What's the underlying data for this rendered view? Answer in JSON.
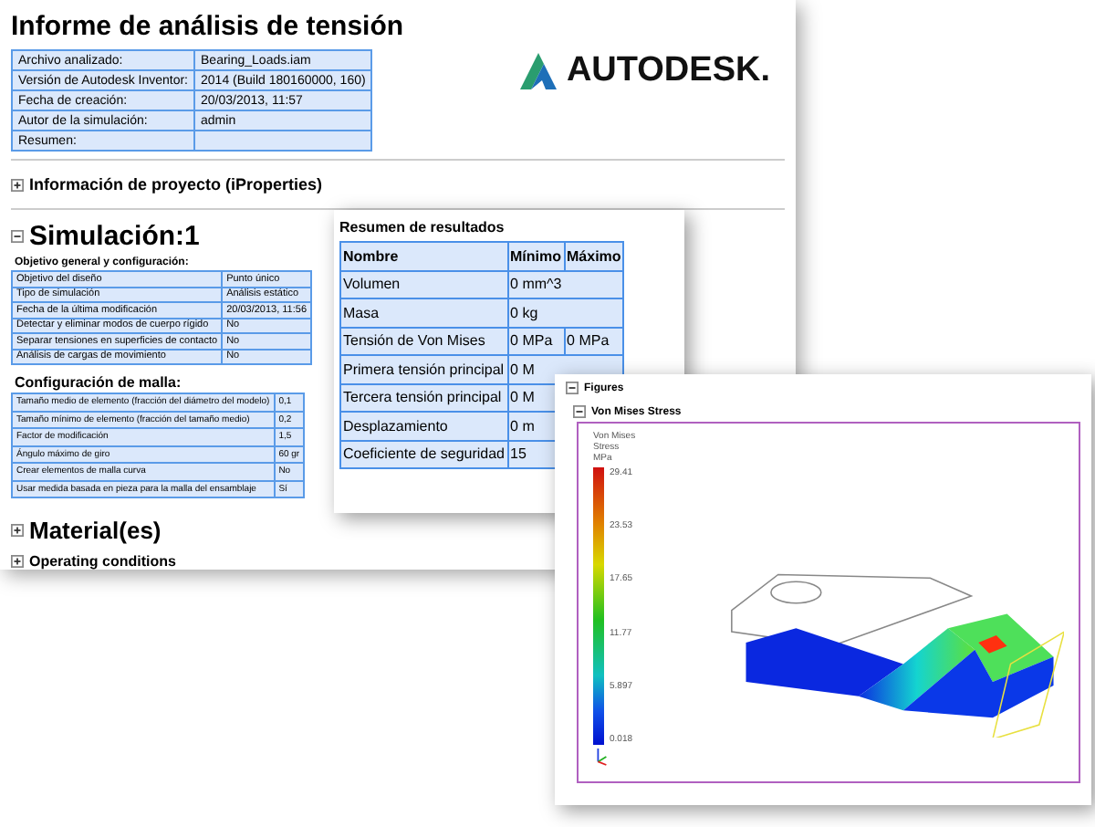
{
  "report": {
    "title": "Informe de análisis de tensión",
    "logo_text": "AUTODESK.",
    "summary": [
      {
        "label": "Archivo analizado:",
        "value": "Bearing_Loads.iam"
      },
      {
        "label": "Versión de Autodesk Inventor:",
        "value": "2014 (Build 180160000, 160)"
      },
      {
        "label": "Fecha de creación:",
        "value": "20/03/2013, 11:57"
      },
      {
        "label": "Autor de la simulación:",
        "value": "admin"
      },
      {
        "label": "Resumen:"
      }
    ],
    "sections": [
      {
        "title": "Información de proyecto (iProperties)",
        "expanded": false
      }
    ],
    "simulation": {
      "title": "Simulación:1",
      "expanded": true,
      "groups": [
        {
          "title": "Objetivo general y configuración:",
          "rows": [
            {
              "label": "Objetivo del diseño",
              "value": "Punto único"
            },
            {
              "label": "Tipo de simulación",
              "value": "Análisis estático"
            },
            {
              "label": "Fecha de la última modificación",
              "value": "20/03/2013, 11:56"
            },
            {
              "label": "Detectar y eliminar modos de cuerpo rígido",
              "value": "No"
            },
            {
              "label": "Separar tensiones en superficies de contacto",
              "value": "No"
            },
            {
              "label": "Análisis de cargas de movimiento",
              "value": "No"
            }
          ]
        },
        {
          "title": "Configuración de malla:",
          "rows": [
            {
              "label": "Tamaño medio de elemento (fracción del diámetro del modelo)",
              "value": "0,1"
            },
            {
              "label": "Tamaño mínimo de elemento (fracción del tamaño medio)",
              "value": "0,2"
            },
            {
              "label": "Factor de modificación",
              "value": "1,5"
            },
            {
              "label": "Ángulo máximo de giro",
              "value": "60 gr"
            },
            {
              "label": "Crear elementos de malla curva",
              "value": "No"
            },
            {
              "label": "Usar medida basada en pieza para la malla del ensamblaje",
              "value": "Sí"
            }
          ]
        }
      ]
    },
    "more_sections": [
      {
        "title": "Material(es)",
        "expanded": false,
        "kind": "large"
      },
      {
        "title": "Operating conditions",
        "expanded": false,
        "kind": "small"
      }
    ]
  },
  "results": {
    "title": "Resumen de resultados",
    "columns": [
      "Nombre",
      "Mínimo",
      "Máximo"
    ],
    "rows": [
      {
        "name": "Volumen",
        "minimum": "0 mm^3"
      },
      {
        "name": "Masa",
        "minimum": "0 kg"
      },
      {
        "name": "Tensión de Von Mises",
        "minimum": "0 MPa",
        "maximum": "0 MPa"
      },
      {
        "name": "Primera tensión principal",
        "minimum": "0 M"
      },
      {
        "name": "Tercera tensión principal",
        "minimum": "0 M"
      },
      {
        "name": "Desplazamiento",
        "minimum": "0 m"
      },
      {
        "name": "Coeficiente de seguridad",
        "minimum": "15"
      }
    ]
  },
  "figures": {
    "title": "Figures",
    "expanded": true,
    "figure": {
      "title": "Von Mises Stress",
      "expanded": true,
      "legend_title": "Von Mises Stress",
      "legend_unit": "MPa",
      "legend_ticks": [
        "29.41",
        "23.53",
        "17.65",
        "11.77",
        "5.897",
        "0.018"
      ]
    }
  }
}
